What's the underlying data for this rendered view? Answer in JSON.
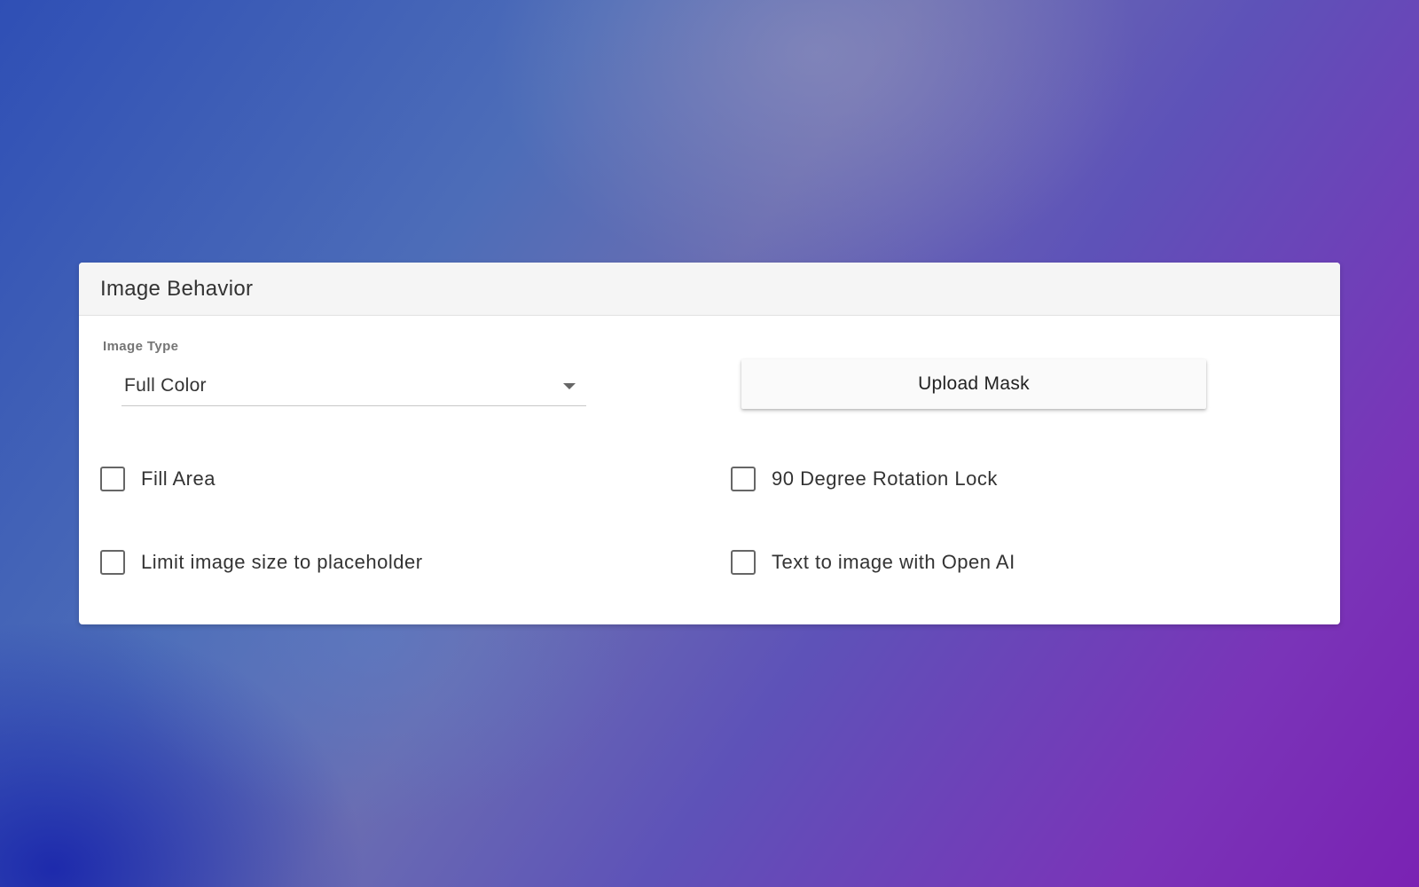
{
  "card": {
    "title": "Image Behavior",
    "image_type": {
      "label": "Image Type",
      "value": "Full Color"
    },
    "upload_button": {
      "label": "Upload Mask"
    },
    "checkboxes": [
      {
        "label": "Fill Area",
        "checked": false
      },
      {
        "label": "90 Degree Rotation Lock",
        "checked": false
      },
      {
        "label": "Limit image size to placeholder",
        "checked": false
      },
      {
        "label": "Text to image with Open AI",
        "checked": false
      }
    ]
  },
  "icons": {
    "dropdown": "chevron-down-icon"
  },
  "colors": {
    "card_header_bg": "#f5f5f5",
    "checkbox_border": "#666666",
    "text": "#333333"
  }
}
